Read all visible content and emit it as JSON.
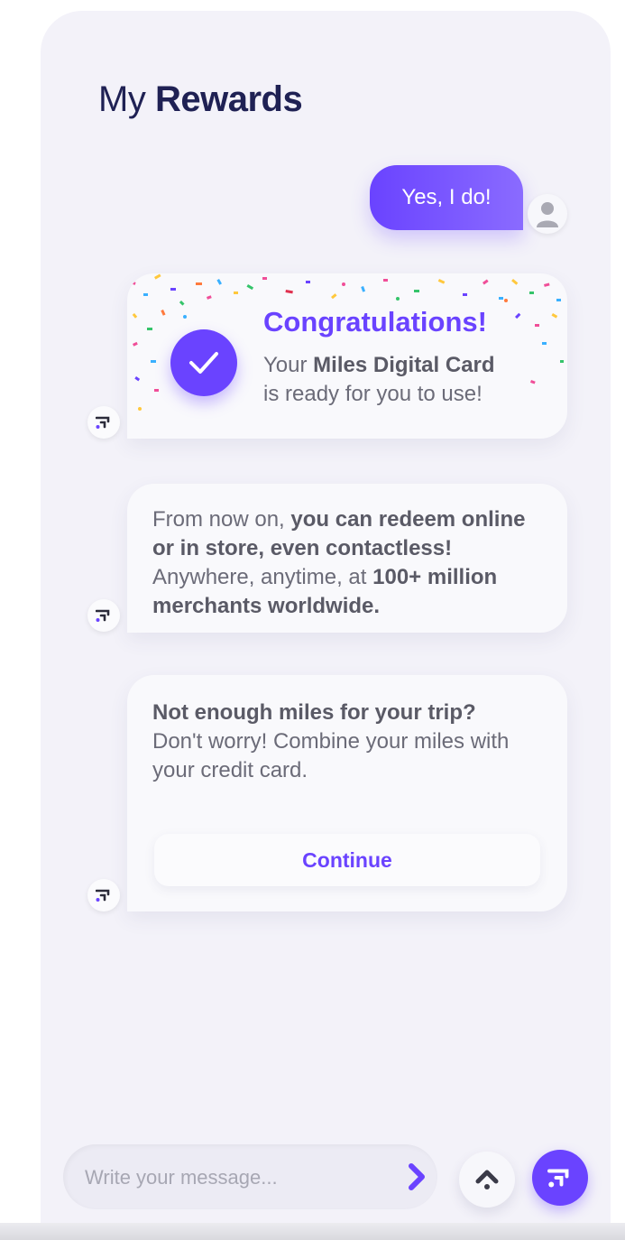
{
  "header": {
    "title_light": "My",
    "title_bold": "Rewards"
  },
  "chat": {
    "user_message": "Yes, I do!",
    "congrats": {
      "title": "Congratulations!",
      "line1_prefix": "Your",
      "line1_bold": "Miles Digital Card",
      "line2": "is ready for you to use!"
    },
    "info": {
      "part1": "From now on,",
      "bold1": "you can redeem online or in store, even contactless!",
      "part2": "Anywhere, anytime, at",
      "bold2": "100+ million merchants worldwide."
    },
    "miles": {
      "bold": "Not enough miles for your trip?",
      "text": "Don't worry! Combine your miles with your credit card.",
      "button_label": "Continue"
    }
  },
  "composer": {
    "placeholder": "Write your message..."
  },
  "icons": {
    "user_avatar": "user-icon",
    "bot_avatar": "brand-logo-icon",
    "send": "chevron-right-icon",
    "scroll_up": "chevron-up-icon",
    "checkmark": "check-icon"
  },
  "colors": {
    "accent": "#6a43ff",
    "title": "#1f2154",
    "background": "#f3f2f9"
  }
}
